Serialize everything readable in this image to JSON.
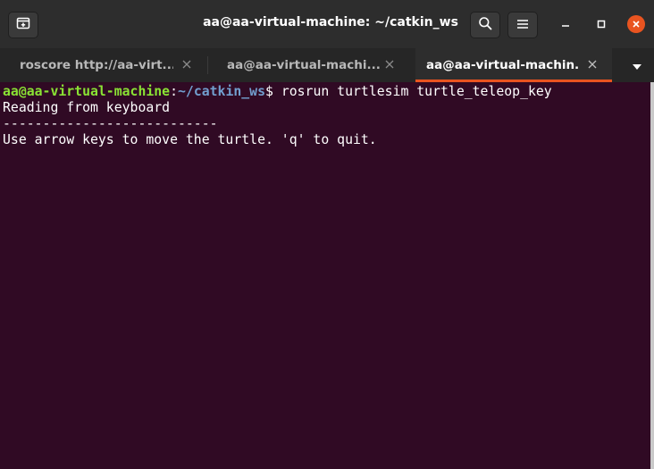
{
  "window": {
    "title": "aa@aa-virtual-machine: ~/catkin_ws"
  },
  "header": {
    "new_tab_icon": "new-tab-icon",
    "search_icon": "search-icon",
    "menu_icon": "hamburger-menu-icon",
    "minimize_icon": "minimize-icon",
    "maximize_icon": "maximize-icon",
    "close_icon": "close-icon"
  },
  "tabs": [
    {
      "label": "roscore http://aa-virt...",
      "active": false
    },
    {
      "label": "aa@aa-virtual-machi...",
      "active": false
    },
    {
      "label": "aa@aa-virtual-machin...",
      "active": true
    }
  ],
  "terminal": {
    "prompt_user": "aa@aa-virtual-machine",
    "prompt_sep": ":",
    "prompt_path": "~/catkin_ws",
    "prompt_end": "$ ",
    "command": "rosrun turtlesim turtle_teleop_key",
    "output": [
      "Reading from keyboard",
      "---------------------------",
      "Use arrow keys to move the turtle. 'q' to quit."
    ]
  },
  "colors": {
    "terminal_bg": "#300a24",
    "accent": "#e95420",
    "prompt_user": "#8ae234",
    "prompt_path": "#729fcf"
  }
}
